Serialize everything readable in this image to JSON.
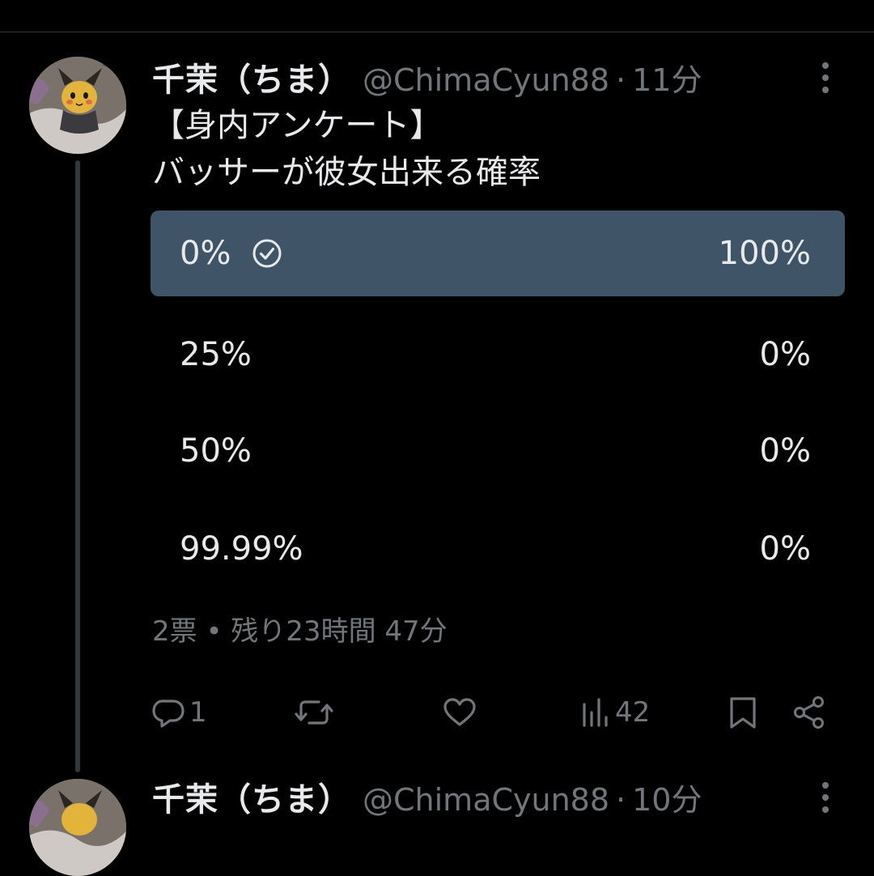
{
  "tweets": [
    {
      "author": {
        "display_name": "千茉（ちま）",
        "handle": "@ChimaCyun88",
        "time_ago": "11分"
      },
      "text_lines": [
        "【身内アンケート】",
        "バッサーが彼女出来る確率"
      ],
      "poll": {
        "options": [
          {
            "label": "0%",
            "percent": "100%",
            "fraction": 1.0,
            "selected": true
          },
          {
            "label": "25%",
            "percent": "0%",
            "fraction": 0.0,
            "selected": false
          },
          {
            "label": "50%",
            "percent": "0%",
            "fraction": 0.0,
            "selected": false
          },
          {
            "label": "99.99%",
            "percent": "0%",
            "fraction": 0.0,
            "selected": false
          }
        ],
        "meta": "2票 • 残り23時間 47分"
      },
      "actions": {
        "reply_count": "1",
        "views_count": "42"
      }
    },
    {
      "author": {
        "display_name": "千茉（ちま）",
        "handle": "@ChimaCyun88",
        "time_ago": "10分"
      }
    }
  ],
  "separator": "·",
  "icons": {
    "more": "more-vertical-icon",
    "check": "check-circle-icon",
    "reply": "reply-icon",
    "retweet": "retweet-icon",
    "like": "heart-icon",
    "views": "views-chart-icon",
    "bookmark": "bookmark-icon",
    "share": "share-icon"
  },
  "colors": {
    "background": "#000000",
    "text_primary": "#e7e9ea",
    "text_secondary": "#71767b",
    "poll_bar_selected": "#3f5466"
  }
}
